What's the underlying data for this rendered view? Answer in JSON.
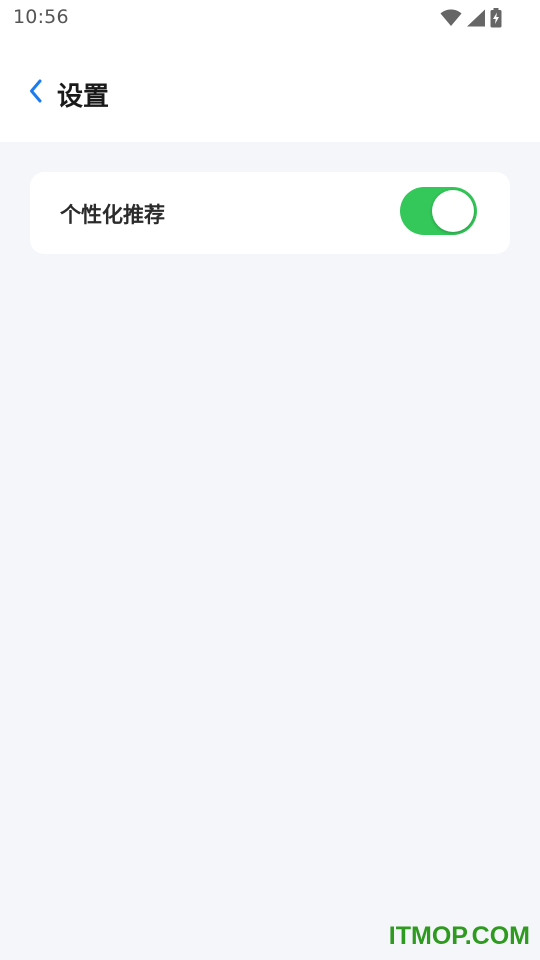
{
  "status_bar": {
    "time": "10:56",
    "icons": [
      "wifi-icon",
      "cellular-signal-icon",
      "battery-charging-icon"
    ]
  },
  "nav": {
    "back_icon": "chevron-left-icon",
    "title": "设置"
  },
  "settings": {
    "items": [
      {
        "label": "个性化推荐",
        "toggle_on": true
      }
    ]
  },
  "watermark": {
    "text": "ITMOP.COM"
  },
  "colors": {
    "accent": "#1a7cf0",
    "toggle_on": "#34c759",
    "watermark": "#2e9a1f",
    "page_background": "#f5f6fa"
  }
}
